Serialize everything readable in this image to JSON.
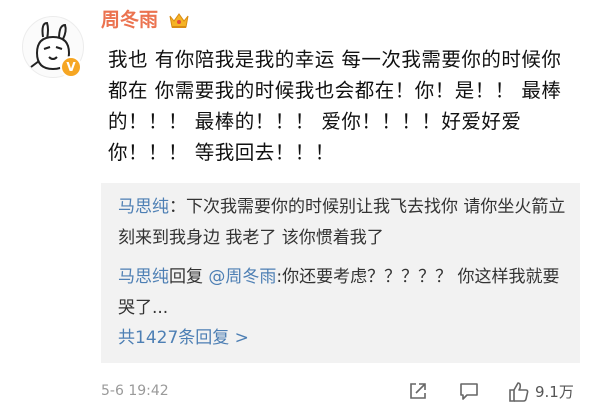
{
  "post": {
    "username": "周冬雨",
    "verified_badge": "V",
    "content": "我也  有你陪我是我的幸运  每一次我需要你的时候你都在   你需要我的时候我也会都在！你！是！！  最棒的！！！  最棒的！！！  爱你！！！！好爱好爱你！！！  等我回去！！！"
  },
  "replies": [
    {
      "author": "马思纯",
      "separator": "：",
      "text": "下次我需要你的时候别让我飞去找你 请你坐火箭立刻来到我身边 我老了 该你惯着我了"
    },
    {
      "author": "马思纯",
      "reply_word": "回复",
      "mention": "@周冬雨",
      "separator": ":",
      "text": "你还要考虑？？？？？ 你这样我就要哭了..."
    }
  ],
  "more_replies_label": "共1427条回复 >",
  "footer": {
    "timestamp": "5-6 19:42",
    "like_count": "9.1万"
  },
  "icons": {
    "crown": "crown-icon",
    "share": "share-icon",
    "comment": "comment-icon",
    "like": "thumbs-up-icon"
  },
  "colors": {
    "username": "#eb7350",
    "link": "#4d7fb4",
    "reply_background": "#f2f2f2",
    "badge": "#f6a623"
  }
}
